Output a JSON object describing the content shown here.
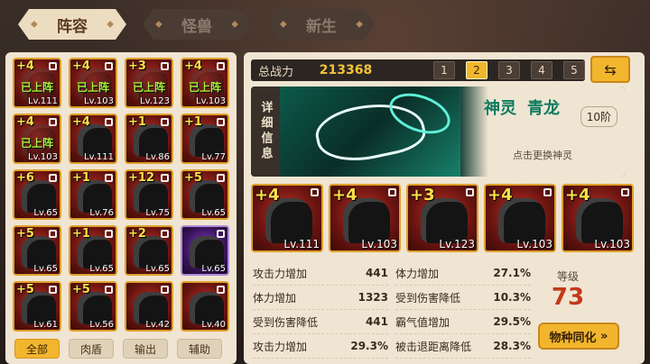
{
  "tabs": [
    "阵容",
    "怪兽",
    "新生"
  ],
  "left_grid": [
    {
      "star": "+4",
      "level": "Lv.111",
      "status": "已上阵",
      "color": "red"
    },
    {
      "star": "+4",
      "level": "Lv.103",
      "status": "已上阵",
      "color": "red"
    },
    {
      "star": "+3",
      "level": "Lv.123",
      "status": "已上阵",
      "color": "red"
    },
    {
      "star": "+4",
      "level": "Lv.103",
      "status": "已上阵",
      "color": "red"
    },
    {
      "star": "+4",
      "level": "Lv.103",
      "status": "已上阵",
      "color": "red"
    },
    {
      "star": "+4",
      "level": "Lv.111",
      "status": "",
      "color": "red"
    },
    {
      "star": "+1",
      "level": "Lv.86",
      "status": "",
      "color": "red"
    },
    {
      "star": "+1",
      "level": "Lv.77",
      "status": "",
      "color": "red"
    },
    {
      "star": "+6",
      "level": "Lv.65",
      "status": "",
      "color": "red"
    },
    {
      "star": "+1",
      "level": "Lv.76",
      "status": "",
      "color": "red"
    },
    {
      "star": "+12",
      "level": "Lv.75",
      "status": "",
      "color": "red"
    },
    {
      "star": "+5",
      "level": "Lv.65",
      "status": "",
      "color": "red"
    },
    {
      "star": "+5",
      "level": "Lv.65",
      "status": "",
      "color": "red"
    },
    {
      "star": "+1",
      "level": "Lv.65",
      "status": "",
      "color": "red"
    },
    {
      "star": "+2",
      "level": "Lv.65",
      "status": "",
      "color": "red"
    },
    {
      "star": "",
      "level": "Lv.65",
      "status": "",
      "color": "purple"
    },
    {
      "star": "+5",
      "level": "Lv.61",
      "status": "",
      "color": "red"
    },
    {
      "star": "+5",
      "level": "Lv.56",
      "status": "",
      "color": "red"
    },
    {
      "star": "",
      "level": "Lv.42",
      "status": "",
      "color": "red"
    },
    {
      "star": "",
      "level": "Lv.40",
      "status": "",
      "color": "red"
    }
  ],
  "filters": [
    "全部",
    "肉盾",
    "输出",
    "辅助"
  ],
  "power_label": "总战力",
  "power_value": "213368",
  "pages": [
    "1",
    "2",
    "3",
    "4",
    "5"
  ],
  "active_page": "2",
  "hero": {
    "side_label": "详细信息",
    "type": "神灵",
    "name": "青龙",
    "rank": "10阶",
    "hint": "点击更换神灵"
  },
  "team": [
    {
      "star": "+4",
      "level": "Lv.111"
    },
    {
      "star": "+4",
      "level": "Lv.103"
    },
    {
      "star": "+3",
      "level": "Lv.123"
    },
    {
      "star": "+4",
      "level": "Lv.103"
    },
    {
      "star": "+4",
      "level": "Lv.103"
    }
  ],
  "stats_left": [
    {
      "k": "攻击力增加",
      "v": "441"
    },
    {
      "k": "体力增加",
      "v": "1323"
    },
    {
      "k": "受到伤害降低",
      "v": "441"
    },
    {
      "k": "攻击力增加",
      "v": "29.3%"
    }
  ],
  "stats_right": [
    {
      "k": "体力增加",
      "v": "27.1%"
    },
    {
      "k": "受到伤害降低",
      "v": "10.3%"
    },
    {
      "k": "霸气值增加",
      "v": "29.5%"
    },
    {
      "k": "被击退距离降低",
      "v": "28.3%"
    }
  ],
  "level_label": "等级",
  "level_value": "73",
  "assim_label": "物种同化"
}
